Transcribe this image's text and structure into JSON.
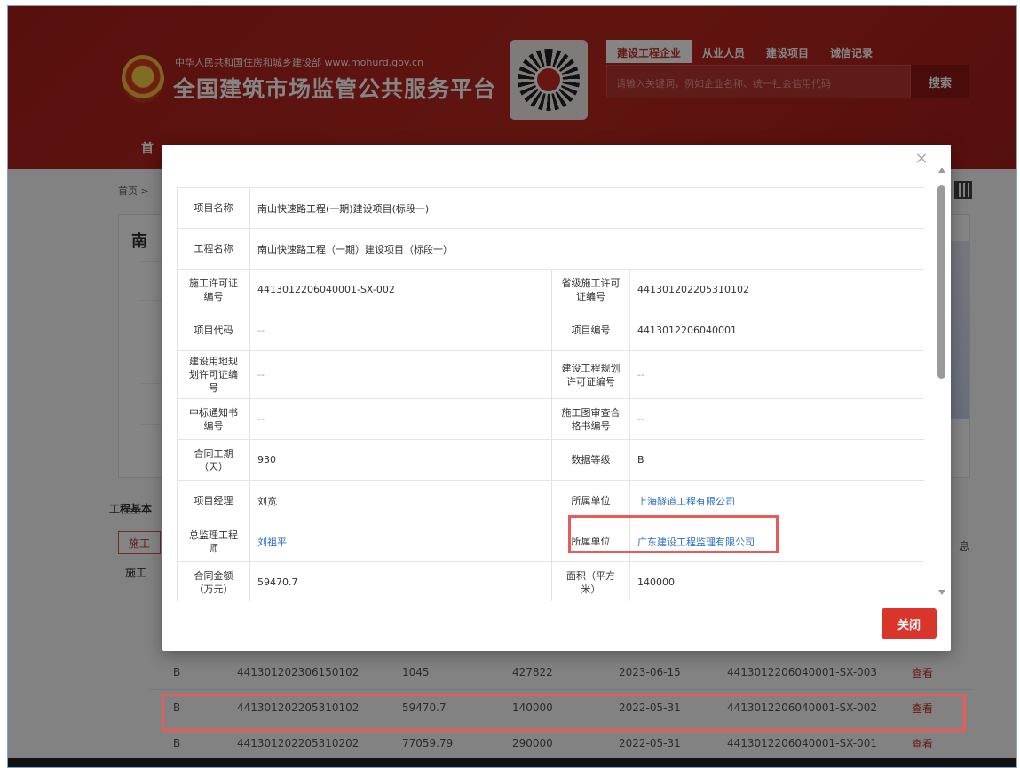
{
  "header": {
    "dept": "中华人民共和国住房和城乡建设部  www.mohurd.gov.cn",
    "title": "全国建筑市场监管公共服务平台",
    "tabs": [
      "建设工程企业",
      "从业人员",
      "建设项目",
      "诚信记录"
    ],
    "search_placeholder": "请输入关键词，例如企业名称、统一社会信用代码",
    "search_button": "搜索",
    "nav_home": "首"
  },
  "page": {
    "breadcrumb": "首页 >",
    "card_title": "南",
    "section_title": "工程基本",
    "sub_tab": "施工",
    "sub_label": "施工",
    "side_char": "息",
    "rows": [
      {
        "grade": "B",
        "permit": "441301202306150102",
        "amount": "1045",
        "area": "427822",
        "date": "2023-06-15",
        "code": "4413012206040001-SX-003",
        "action": "查看"
      },
      {
        "grade": "B",
        "permit": "441301202205310102",
        "amount": "59470.7",
        "area": "140000",
        "date": "2022-05-31",
        "code": "4413012206040001-SX-002",
        "action": "查看"
      },
      {
        "grade": "B",
        "permit": "441301202205310202",
        "amount": "77059.79",
        "area": "290000",
        "date": "2022-05-31",
        "code": "4413012206040001-SX-001",
        "action": "查看"
      }
    ]
  },
  "modal": {
    "close_icon": "×",
    "close_button": "关闭",
    "project_name_label": "项目名称",
    "project_name": "南山快速路工程(一期)建设项目(标段一)",
    "eng_name_label": "工程名称",
    "eng_name": "南山快速路工程（一期）建设项目（标段一）",
    "permit_no_label": "施工许可证编号",
    "permit_no": "4413012206040001-SX-002",
    "prov_permit_label": "省级施工许可证编号",
    "prov_permit": "441301202205310102",
    "proj_code_label": "项目代码",
    "proj_code": "--",
    "proj_no_label": "项目编号",
    "proj_no": "4413012206040001",
    "land_plan_label": "建设用地规划许可证编号",
    "land_plan": "--",
    "eng_plan_label": "建设工程规划许可证编号",
    "eng_plan": "--",
    "bid_notice_label": "中标通知书编号",
    "bid_notice": "--",
    "drawing_review_label": "施工图审查合格书编号",
    "drawing_review": "--",
    "contract_period_label": "合同工期（天）",
    "contract_period": "930",
    "data_grade_label": "数据等级",
    "data_grade": "B",
    "pm_label": "项目经理",
    "pm": "刘宽",
    "pm_unit_label": "所属单位",
    "pm_unit": "上海隧道工程有限公司",
    "supervisor_label": "总监理工程师",
    "supervisor": "刘祖平",
    "sup_unit_label": "所属单位",
    "sup_unit": "广东建设工程监理有限公司",
    "contract_amount_label": "合同金额（万元）",
    "contract_amount": "59470.7",
    "area_label": "面积（平方米）",
    "area": "140000"
  },
  "colors": {
    "brand_red": "#b8281f",
    "link_blue": "#2a6fc9",
    "highlight": "#e95a58"
  }
}
